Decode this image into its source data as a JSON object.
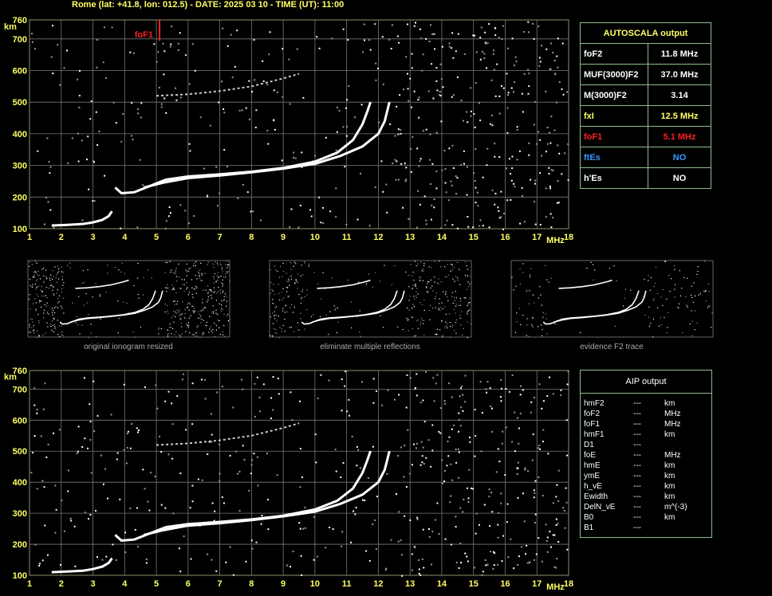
{
  "header": {
    "text": "Rome (lat: +41.8, lon: 012.5) - DATE: 2025 03 10 - TIME (UT): 11:00"
  },
  "chart_data": [
    {
      "type": "scatter",
      "name": "main-ionogram",
      "x_ticks": [
        "1",
        "2",
        "3",
        "4",
        "5",
        "6",
        "7",
        "8",
        "9",
        "10",
        "11",
        "12",
        "13",
        "14",
        "15",
        "16",
        "17",
        "18"
      ],
      "y_ticks": [
        "100",
        "200",
        "300",
        "400",
        "500",
        "600",
        "700",
        "760"
      ],
      "xlabel": "MHz",
      "ylabel": "km",
      "xlim": [
        1,
        18
      ],
      "ylim": [
        100,
        760
      ],
      "grid": true,
      "annotations": [
        {
          "label": "foF1",
          "x": 5.1,
          "color": "#ff2020"
        }
      ],
      "traces": {
        "e_layer": [
          [
            1.7,
            110
          ],
          [
            2.2,
            112
          ],
          [
            2.7,
            115
          ],
          [
            3.0,
            120
          ],
          [
            3.3,
            128
          ],
          [
            3.5,
            140
          ],
          [
            3.6,
            155
          ]
        ],
        "o_trace": [
          [
            3.7,
            230
          ],
          [
            3.9,
            212
          ],
          [
            4.3,
            215
          ],
          [
            4.8,
            235
          ],
          [
            5.3,
            255
          ],
          [
            6,
            265
          ],
          [
            7,
            272
          ],
          [
            8,
            280
          ],
          [
            9,
            292
          ],
          [
            10,
            312
          ],
          [
            10.7,
            340
          ],
          [
            11.2,
            380
          ],
          [
            11.5,
            430
          ],
          [
            11.65,
            470
          ],
          [
            11.75,
            500
          ]
        ],
        "x_trace": [
          [
            4.6,
            230
          ],
          [
            5.2,
            245
          ],
          [
            6,
            260
          ],
          [
            7,
            268
          ],
          [
            8,
            278
          ],
          [
            9,
            290
          ],
          [
            10,
            305
          ],
          [
            10.8,
            330
          ],
          [
            11.5,
            360
          ],
          [
            12.0,
            400
          ],
          [
            12.2,
            440
          ],
          [
            12.35,
            500
          ]
        ],
        "spread_faint": [
          [
            5.0,
            520
          ],
          [
            6,
            525
          ],
          [
            7,
            535
          ],
          [
            8,
            550
          ],
          [
            9,
            575
          ],
          [
            9.5,
            590
          ]
        ]
      }
    },
    {
      "type": "scatter",
      "name": "aip-ionogram",
      "x_ticks": [
        "1",
        "2",
        "3",
        "4",
        "5",
        "6",
        "7",
        "8",
        "9",
        "10",
        "11",
        "12",
        "13",
        "14",
        "15",
        "16",
        "17",
        "18"
      ],
      "y_ticks": [
        "100",
        "200",
        "300",
        "400",
        "500",
        "600",
        "700",
        "760"
      ],
      "xlabel": "MHz",
      "ylabel": "km",
      "xlim": [
        1,
        18
      ],
      "ylim": [
        100,
        760
      ],
      "grid": true
    }
  ],
  "thumbnails": [
    {
      "caption": "original ionogram resized"
    },
    {
      "caption": "eliminate multiple reflections"
    },
    {
      "caption": "evidence F2 trace"
    }
  ],
  "autoscala": {
    "title": "AUTOSCALA output",
    "rows": [
      {
        "label": "foF2",
        "value": "11.8 MHz",
        "color": "#ffffff"
      },
      {
        "label": "MUF(3000)F2",
        "value": "37.0 MHz",
        "color": "#ffffff"
      },
      {
        "label": "M(3000)F2",
        "value": "3.14",
        "color": "#ffffff"
      },
      {
        "label": "fxI",
        "value": "12.5 MHz",
        "color": "#ffff66"
      },
      {
        "label": "foF1",
        "value": "5.1 MHz",
        "color": "#ff2020"
      },
      {
        "label": "ftEs",
        "value": "NO",
        "color": "#3399ff"
      },
      {
        "label": "h'Es",
        "value": "NO",
        "color": "#ffffff"
      }
    ]
  },
  "aip": {
    "title": "AIP output",
    "rows": [
      {
        "label": "hmF2",
        "value": "---",
        "unit": "km"
      },
      {
        "label": "foF2",
        "value": "---",
        "unit": "MHz"
      },
      {
        "label": "foF1",
        "value": "---",
        "unit": "MHz"
      },
      {
        "label": "hmF1",
        "value": "---",
        "unit": "km"
      },
      {
        "label": "D1",
        "value": "---",
        "unit": ""
      },
      {
        "label": "foE",
        "value": "---",
        "unit": "MHz"
      },
      {
        "label": "hmE",
        "value": "---",
        "unit": "km"
      },
      {
        "label": "ymE",
        "value": "---",
        "unit": "km"
      },
      {
        "label": "h_vE",
        "value": "---",
        "unit": "km"
      },
      {
        "label": "Ewidth",
        "value": "---",
        "unit": "km"
      },
      {
        "label": "DelN_vE",
        "value": "---",
        "unit": "m^(-3)"
      },
      {
        "label": "B0",
        "value": "---",
        "unit": "km"
      },
      {
        "label": "B1",
        "value": "---",
        "unit": ""
      }
    ]
  }
}
